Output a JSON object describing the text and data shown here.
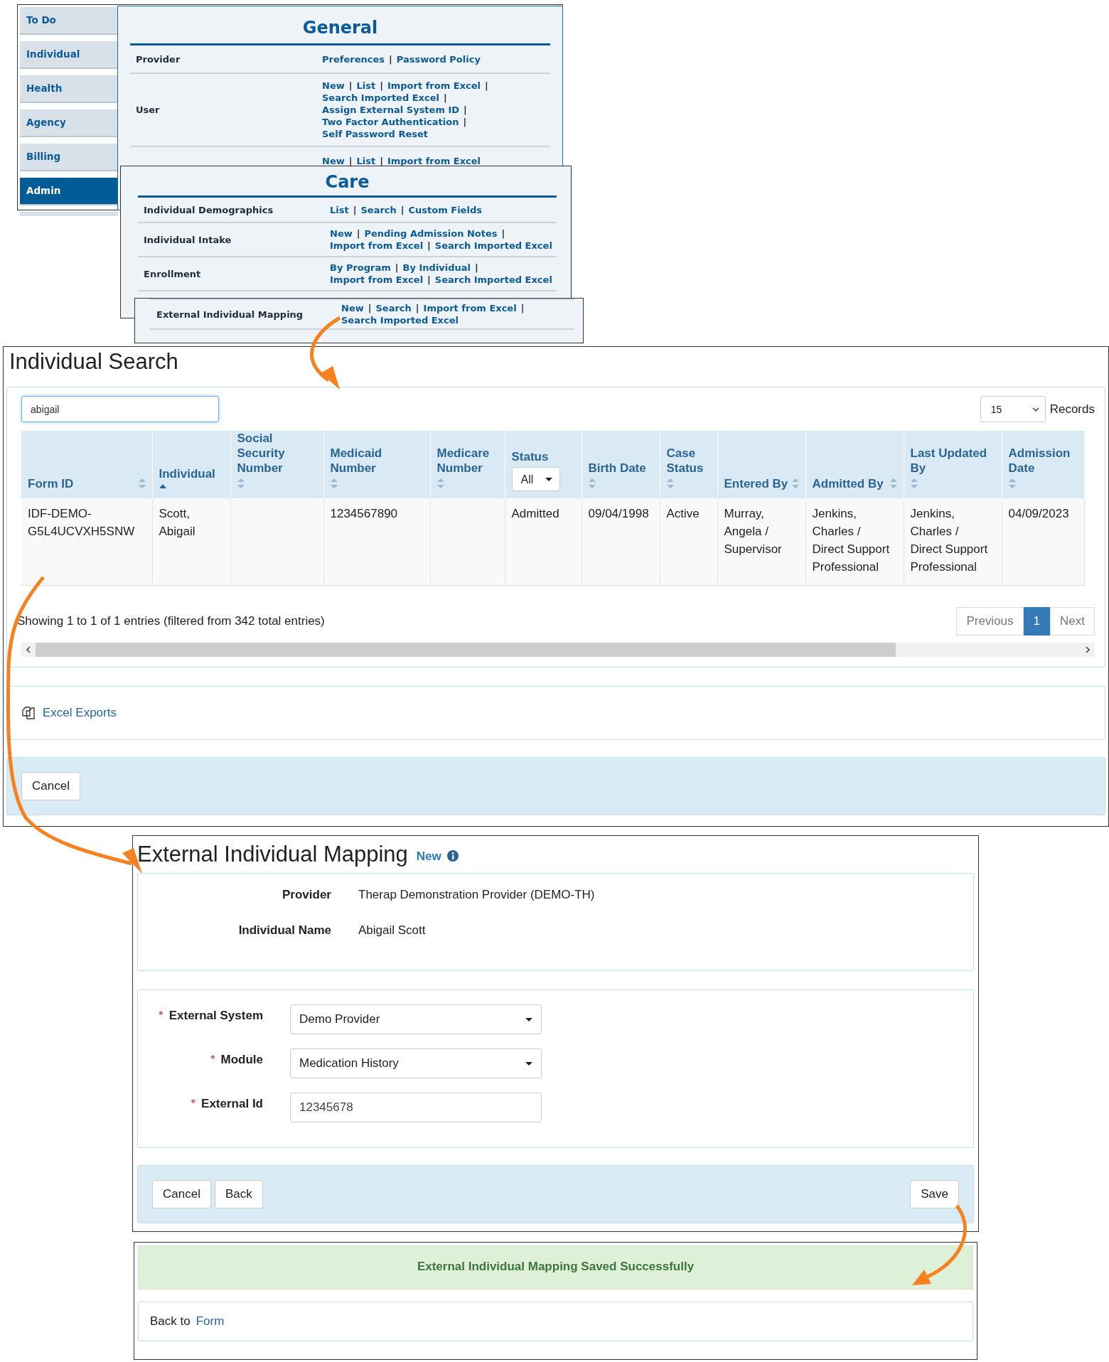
{
  "nav": {
    "items": [
      {
        "label": "To Do",
        "selected": false
      },
      {
        "label": "Individual",
        "selected": false
      },
      {
        "label": "Health",
        "selected": false
      },
      {
        "label": "Agency",
        "selected": false
      },
      {
        "label": "Billing",
        "selected": false
      },
      {
        "label": "Admin",
        "selected": true
      }
    ]
  },
  "separator": "|",
  "general_panel": {
    "title": "General",
    "rows": [
      {
        "label": "Provider",
        "lines": [
          [
            "Preferences",
            "Password Policy"
          ]
        ]
      },
      {
        "label": "User",
        "lines": [
          [
            "New",
            "List",
            "Import from Excel"
          ],
          [
            "Search Imported Excel"
          ],
          [
            "Assign External System ID"
          ],
          [
            "Two Factor Authentication"
          ],
          [
            "Self Password Reset"
          ]
        ]
      },
      {
        "label": "",
        "lines": [
          [
            "New",
            "List",
            "Import from Excel"
          ]
        ]
      }
    ]
  },
  "care_panel": {
    "title": "Care",
    "rows": [
      {
        "label": "Individual Demographics",
        "lines": [
          [
            "List",
            "Search",
            "Custom Fields"
          ]
        ]
      },
      {
        "label": "Individual Intake",
        "lines": [
          [
            "New",
            "Pending Admission Notes"
          ],
          [
            "Import from Excel",
            "Search Imported Excel"
          ]
        ]
      },
      {
        "label": "Enrollment",
        "lines": [
          [
            "By Program",
            "By Individual"
          ],
          [
            "Import from Excel",
            "Search Imported Excel"
          ]
        ]
      }
    ]
  },
  "mapping_menu_row": {
    "label": "External Individual Mapping",
    "lines": [
      [
        "New",
        "Search",
        "Import from Excel"
      ],
      [
        "Search Imported Excel"
      ]
    ]
  },
  "individual_search": {
    "title": "Individual Search",
    "search_value": "abigail",
    "page_size": "15",
    "records_label": "Records",
    "columns": [
      {
        "label": "Form ID",
        "sorted": false
      },
      {
        "label": "Individual",
        "sorted": true
      },
      {
        "label": "Social Security Number",
        "sorted": false
      },
      {
        "label": "Medicaid Number",
        "sorted": false
      },
      {
        "label": "Medicare Number",
        "sorted": false
      },
      {
        "label": "Status",
        "filter": "All"
      },
      {
        "label": "Birth Date",
        "sorted": false
      },
      {
        "label": "Case Status",
        "sorted": false
      },
      {
        "label": "Entered By",
        "sorted": false
      },
      {
        "label": "Admitted By",
        "sorted": false
      },
      {
        "label": "Last Updated By",
        "sorted": false
      },
      {
        "label": "Admission Date",
        "sorted": false
      }
    ],
    "rows": [
      [
        "IDF-DEMO-G5L4UCVXH5SNW",
        "Scott, Abigail",
        "",
        "1234567890",
        "",
        "Admitted",
        "09/04/1998",
        "Active",
        "Murray, Angela / Supervisor",
        "Jenkins, Charles / Direct Support Professional",
        "Jenkins, Charles / Direct Support Professional",
        "04/09/2023"
      ]
    ],
    "info": "Showing 1 to 1 of 1 entries (filtered from 342 total entries)",
    "pagination": [
      {
        "label": "Previous",
        "selected": false
      },
      {
        "label": "1",
        "selected": true
      },
      {
        "label": "Next",
        "selected": false
      }
    ],
    "export_link": "Excel Exports",
    "cancel": "Cancel"
  },
  "mapping_form": {
    "title": "External Individual Mapping",
    "badge": "New",
    "details": [
      {
        "label": "Provider",
        "value": "Therap Demonstration Provider (DEMO-TH)"
      },
      {
        "label": "Individual Name",
        "value": "Abigail Scott"
      }
    ],
    "fields": [
      {
        "label": "External System",
        "marker": "*",
        "kind": "select",
        "value": "Demo Provider"
      },
      {
        "label": "Module",
        "marker": "*",
        "kind": "select",
        "value": "Medication History"
      },
      {
        "label": "External Id",
        "marker": "*",
        "kind": "text",
        "value": "12345678"
      }
    ],
    "buttons": [
      "Cancel",
      "Back"
    ],
    "save": "Save"
  },
  "success": {
    "message": "External Individual Mapping Saved Successfully",
    "back_text": "Back to",
    "back_link": "Form"
  }
}
